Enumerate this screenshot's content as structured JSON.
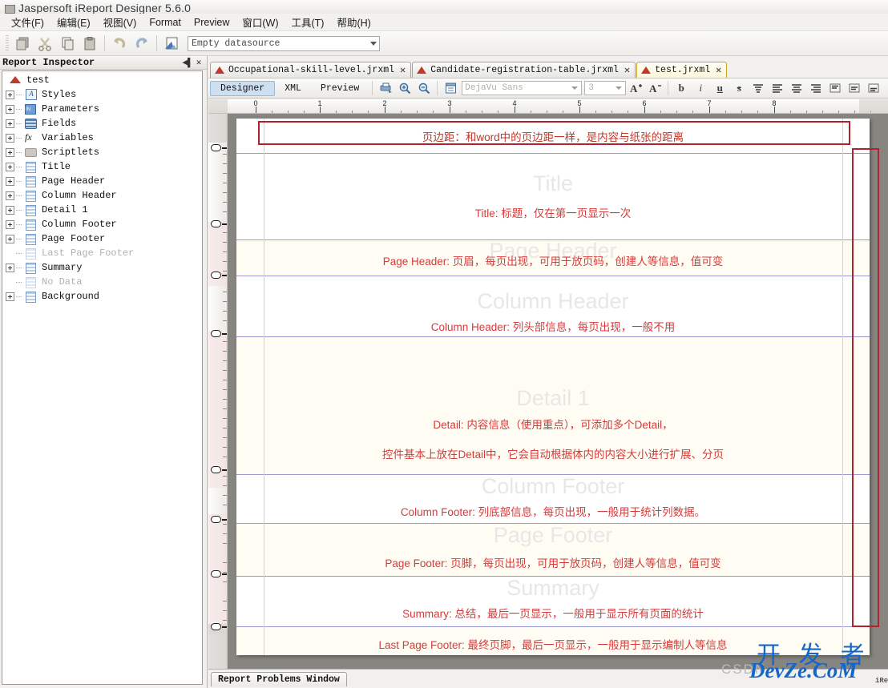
{
  "window": {
    "title": "Jaspersoft iReport Designer 5.6.0",
    "app_icon": "ireport-app-icon"
  },
  "menubar": {
    "items": [
      {
        "label": "文件(F)",
        "mnemonic": "F"
      },
      {
        "label": "编辑(E)",
        "mnemonic": "E"
      },
      {
        "label": "视图(V)",
        "mnemonic": "V"
      },
      {
        "label": "Format",
        "mnemonic": ""
      },
      {
        "label": "Preview",
        "mnemonic": ""
      },
      {
        "label": "窗口(W)",
        "mnemonic": "W"
      },
      {
        "label": "工具(T)",
        "mnemonic": "T"
      },
      {
        "label": "帮助(H)",
        "mnemonic": "H"
      }
    ]
  },
  "main_toolbar": {
    "buttons": [
      {
        "name": "new-report-icon",
        "title": "New"
      },
      {
        "name": "cut-icon",
        "title": "Cut"
      },
      {
        "name": "copy-icon",
        "title": "Copy"
      },
      {
        "name": "paste-icon",
        "title": "Paste"
      },
      {
        "name": "undo-icon",
        "title": "Undo"
      },
      {
        "name": "redo-icon",
        "title": "Redo"
      },
      {
        "name": "report-wizard-icon",
        "title": "Report Wizard"
      }
    ],
    "datasource": {
      "value": "Empty datasource",
      "placeholder": "Empty datasource"
    }
  },
  "inspector": {
    "title": "Report Inspector",
    "minimize_glyph": "◀▌",
    "close_glyph": "✕",
    "tree": [
      {
        "label": "test",
        "icon": "report-root-icon",
        "expandable": false,
        "root": true,
        "disabled": false
      },
      {
        "label": "Styles",
        "icon": "styles-icon",
        "expandable": true,
        "root": false,
        "disabled": false
      },
      {
        "label": "Parameters",
        "icon": "parameters-icon",
        "expandable": true,
        "root": false,
        "disabled": false
      },
      {
        "label": "Fields",
        "icon": "fields-icon",
        "expandable": true,
        "root": false,
        "disabled": false
      },
      {
        "label": "Variables",
        "icon": "variables-icon",
        "expandable": true,
        "root": false,
        "disabled": false
      },
      {
        "label": "Scriptlets",
        "icon": "scriptlets-icon",
        "expandable": true,
        "root": false,
        "disabled": false
      },
      {
        "label": "Title",
        "icon": "band-icon",
        "expandable": true,
        "root": false,
        "disabled": false
      },
      {
        "label": "Page Header",
        "icon": "band-icon",
        "expandable": true,
        "root": false,
        "disabled": false
      },
      {
        "label": "Column Header",
        "icon": "band-icon",
        "expandable": true,
        "root": false,
        "disabled": false
      },
      {
        "label": "Detail 1",
        "icon": "band-icon",
        "expandable": true,
        "root": false,
        "disabled": false
      },
      {
        "label": "Column Footer",
        "icon": "band-icon",
        "expandable": true,
        "root": false,
        "disabled": false
      },
      {
        "label": "Page Footer",
        "icon": "band-icon",
        "expandable": true,
        "root": false,
        "disabled": false
      },
      {
        "label": "Last Page Footer",
        "icon": "band-icon",
        "expandable": false,
        "root": false,
        "disabled": true
      },
      {
        "label": "Summary",
        "icon": "band-icon",
        "expandable": true,
        "root": false,
        "disabled": false
      },
      {
        "label": "No Data",
        "icon": "band-icon",
        "expandable": false,
        "root": false,
        "disabled": true
      },
      {
        "label": "Background",
        "icon": "band-icon",
        "expandable": true,
        "root": false,
        "disabled": false
      }
    ]
  },
  "editor": {
    "tabs": [
      {
        "label": "Occupational-skill-level.jrxml",
        "active": false,
        "close_glyph": "✕"
      },
      {
        "label": "Candidate-registration-table.jrxml",
        "active": false,
        "close_glyph": "✕"
      },
      {
        "label": "test.jrxml",
        "active": true,
        "close_glyph": "✕"
      }
    ],
    "view_tabs": [
      {
        "label": "Designer",
        "selected": true
      },
      {
        "label": "XML",
        "selected": false
      },
      {
        "label": "Preview",
        "selected": false
      }
    ],
    "tool_buttons": [
      {
        "name": "print-preview-icon"
      },
      {
        "name": "zoom-in-icon"
      },
      {
        "name": "zoom-out-icon"
      },
      {
        "name": "format-band-icon"
      }
    ],
    "font_name": {
      "value": "DejaVu Sans",
      "placeholder": "DejaVu Sans"
    },
    "font_size": {
      "value": "3",
      "placeholder": "3"
    },
    "format_buttons": [
      {
        "name": "increase-font-size-icon",
        "glyph": "A"
      },
      {
        "name": "decrease-font-size-icon",
        "glyph": "A"
      },
      {
        "name": "bold-icon",
        "glyph": "b"
      },
      {
        "name": "italic-icon",
        "glyph": "i"
      },
      {
        "name": "underline-icon",
        "glyph": "u"
      },
      {
        "name": "strikethrough-icon",
        "glyph": "s"
      },
      {
        "name": "align-top-icon",
        "glyph": "≡"
      },
      {
        "name": "align-left-icon",
        "glyph": "≡"
      },
      {
        "name": "align-center-icon",
        "glyph": "≡"
      },
      {
        "name": "align-right-icon",
        "glyph": "≡"
      },
      {
        "name": "valign-top-icon",
        "glyph": "▤"
      },
      {
        "name": "valign-middle-icon",
        "glyph": "▤"
      },
      {
        "name": "valign-bottom-icon",
        "glyph": "▤"
      }
    ]
  },
  "rulers": {
    "horizontal_ticks": [
      "0",
      "1",
      "2",
      "3",
      "4",
      "5",
      "6",
      "7",
      "8"
    ]
  },
  "canvas": {
    "margin_note": "页边距：和word中的页边距一样，是内容与纸张的距离",
    "bands": [
      {
        "key": "title",
        "watermark": "Title",
        "annotation": "Title: 标题，仅在第一页显示一次",
        "annotation2": ""
      },
      {
        "key": "page_header",
        "watermark": "Page Header",
        "annotation": "Page Header: 页眉，每页出现，可用于放页码，创建人等信息，值可变",
        "annotation2": ""
      },
      {
        "key": "column_header",
        "watermark": "Column Header",
        "annotation": "Column Header: 列头部信息，每页出现，一般不用",
        "annotation2": ""
      },
      {
        "key": "detail_1",
        "watermark": "Detail 1",
        "annotation": "Detail: 内容信息（使用重点），可添加多个Detail，",
        "annotation2": "控件基本上放在Detail中，它会自动根据体内的内容大小进行扩展、分页"
      },
      {
        "key": "column_footer",
        "watermark": "Column Footer",
        "annotation": "Column Footer: 列底部信息，每页出现，一般用于统计列数据。",
        "annotation2": ""
      },
      {
        "key": "page_footer",
        "watermark": "Page Footer",
        "annotation": "Page Footer: 页脚，每页出现，可用于放页码，创建人等信息，值可变",
        "annotation2": ""
      },
      {
        "key": "summary",
        "watermark": "Summary",
        "annotation": "Summary: 总结，最后一页显示，一般用于显示所有页面的统计",
        "annotation2": ""
      }
    ],
    "last_page_footer_note": "Last Page Footer: 最终页脚，最后一页显示，一般用于显示编制人等信息"
  },
  "bottom_panel": {
    "tab_label": "Report Problems Window"
  },
  "watermark": {
    "cn": "开 发 者",
    "en": "DevZe.CoM",
    "csdn": "CSDN",
    "corner": "iRe"
  },
  "colors": {
    "annotation_red": "#d43b3b",
    "redbox_border": "#b2222c",
    "band_separator": "#9a9ad0",
    "watermark_blue": "#1466c8",
    "active_tab_border": "#c9a227",
    "paper_tint": "#fffdf3"
  }
}
